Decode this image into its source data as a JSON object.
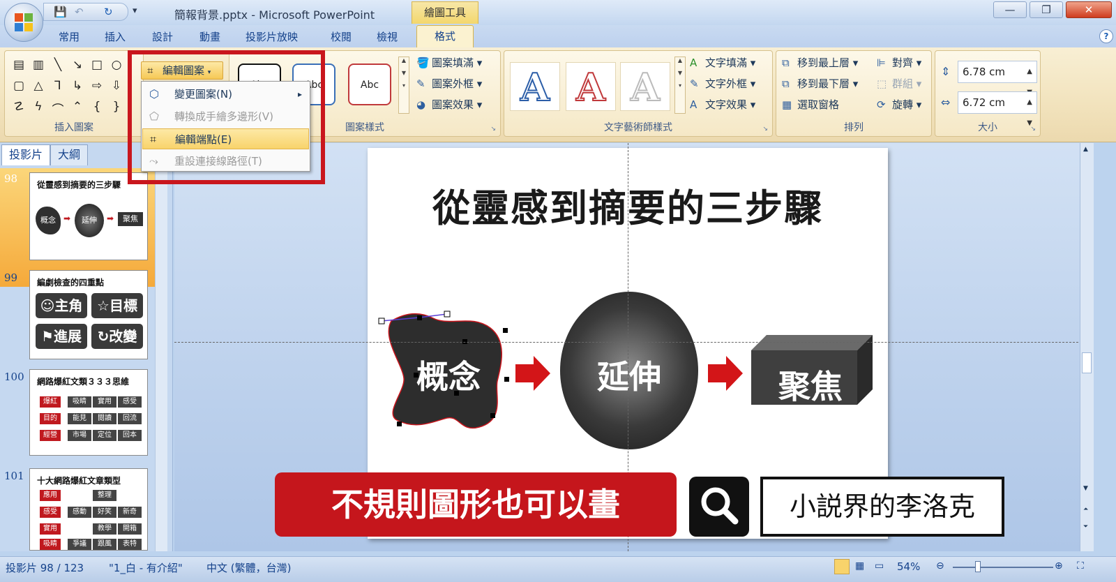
{
  "titlebar": {
    "document_title": "簡報背景.pptx - Microsoft PowerPoint",
    "contextual_tools": "繪圖工具",
    "qat": {
      "save": "💾",
      "undo": "↶",
      "redo": "↻",
      "customize": "▾"
    },
    "window": {
      "minimize": "—",
      "restore": "❐",
      "close": "✕"
    }
  },
  "ribbon_tabs": [
    "常用",
    "插入",
    "設計",
    "動畫",
    "投影片放映",
    "校閱",
    "檢視",
    "格式"
  ],
  "ribbon": {
    "insert_shapes": {
      "label": "插入圖案",
      "edit_shape_button": "編輯圖案"
    },
    "shape_styles": {
      "label": "圖案樣式",
      "style_samples": [
        "Abc",
        "Abc",
        "Abc"
      ],
      "fill": "圖案填滿",
      "outline": "圖案外框",
      "effects": "圖案效果"
    },
    "wordart_styles": {
      "label": "文字藝術師樣式",
      "samples": [
        "A",
        "A",
        "A"
      ],
      "text_fill": "文字填滿",
      "text_outline": "文字外框",
      "text_effects": "文字效果"
    },
    "arrange": {
      "label": "排列",
      "bring_to_front": "移到最上層",
      "send_to_back": "移到最下層",
      "selection_pane": "選取窗格",
      "align": "對齊",
      "group": "群組",
      "rotate": "旋轉"
    },
    "size": {
      "label": "大小",
      "height": "6.78 cm",
      "width": "6.72 cm"
    }
  },
  "edit_shape_menu": [
    {
      "label": "變更圖案(N)",
      "state": "normal",
      "submenu": "▸"
    },
    {
      "label": "轉換成手繪多邊形(V)",
      "state": "disabled"
    },
    {
      "label": "編輯端點(E)",
      "state": "highlighted"
    },
    {
      "label": "重設連接線路徑(T)",
      "state": "disabled"
    }
  ],
  "slide_pane": {
    "tabs": [
      "投影片",
      "大綱"
    ],
    "close": "✕",
    "thumbnails": [
      {
        "number": "98",
        "title": "從靈感到摘要的三步驟",
        "items": [
          "概念",
          "延伸",
          "聚焦"
        ]
      },
      {
        "number": "99",
        "title": "編劇檢查的四重點",
        "items": [
          "☺主角",
          "☆目標",
          "⚑進展",
          "↻改變"
        ]
      },
      {
        "number": "100",
        "title": "網路爆紅文類３３３思維",
        "rows": [
          [
            "爆紅",
            "吸睛",
            "實用",
            "感受"
          ],
          [
            "目的",
            "能見",
            "閱讀",
            "回流"
          ],
          [
            "經營",
            "市場",
            "定位",
            "回本"
          ]
        ]
      },
      {
        "number": "101",
        "title": "十大網路爆紅文章類型",
        "rows": [
          [
            "應用",
            "",
            "整理",
            ""
          ],
          [
            "感受",
            "感動",
            "好笑",
            "新奇"
          ],
          [
            "實用",
            "",
            "教學",
            "開箱"
          ],
          [
            "吸睛",
            "爭議",
            "跟風",
            "表特"
          ]
        ]
      }
    ]
  },
  "slide": {
    "title": "從靈感到摘要的三步驟",
    "steps": [
      "概念",
      "延伸",
      "聚焦"
    ]
  },
  "overlay": {
    "caption": "不規則圖形也可以畫",
    "author": "小説界的李洛克"
  },
  "statusbar": {
    "slide_counter": "投影片 98 / 123",
    "theme": "\"1_白 - 有介紹\"",
    "language": "中文 (繁體，台灣)",
    "zoom": "54%"
  }
}
